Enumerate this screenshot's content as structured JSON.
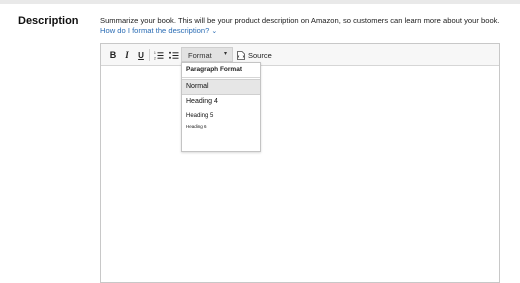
{
  "field": {
    "label": "Description",
    "help_text": "Summarize your book. This will be your product description on Amazon, so customers can learn more about your book.",
    "help_link": "How do I format the description?",
    "help_link_caret": "⌄"
  },
  "toolbar": {
    "bold": "B",
    "italic": "I",
    "underline": "U",
    "numbered_list_icon": "numbered-list-icon",
    "bulleted_list_icon": "bulleted-list-icon",
    "format_label": "Format",
    "format_arrow": "▾",
    "source_label": "Source"
  },
  "format_dropdown": {
    "header": "Paragraph Format",
    "options": [
      "Normal",
      "Heading 4",
      "Heading 5",
      "Heading 6"
    ],
    "highlighted": "Normal"
  },
  "colors": {
    "link": "#2a6cb4",
    "toolbar_bg": "#f7f7f7",
    "highlight": "#e6e6e6"
  }
}
